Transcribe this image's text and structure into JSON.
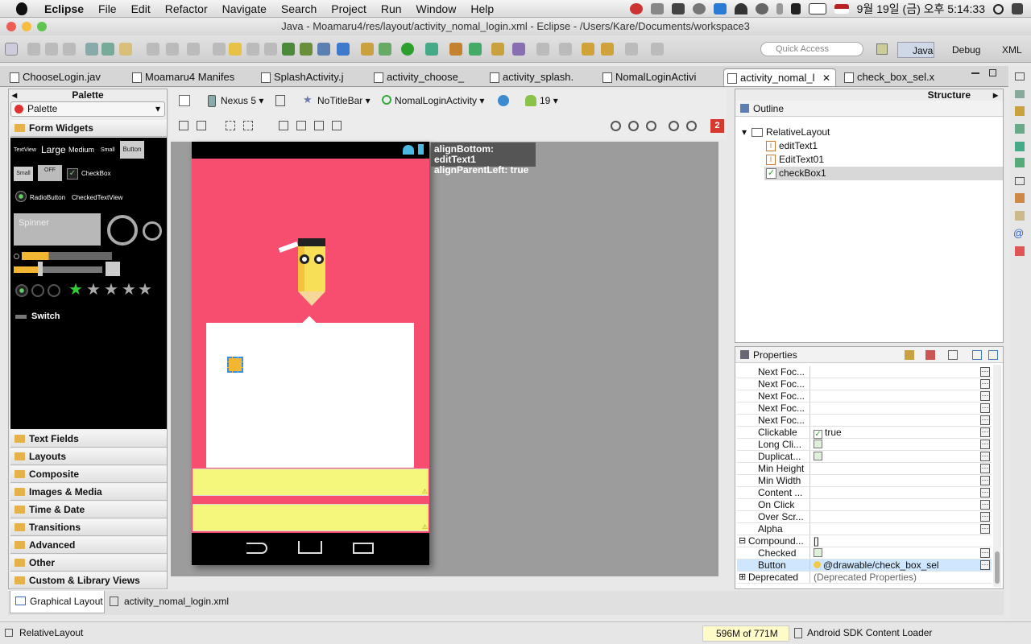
{
  "menubar": {
    "app": "Eclipse",
    "items": [
      "File",
      "Edit",
      "Refactor",
      "Navigate",
      "Search",
      "Project",
      "Run",
      "Window",
      "Help"
    ],
    "clock": "9월 19일 (금) 오후  5:14:33"
  },
  "window": {
    "title": "Java - Moamaru4/res/layout/activity_nomal_login.xml - Eclipse - /Users/Kare/Documents/workspace3"
  },
  "toolbar": {
    "quick_access_placeholder": "Quick Access",
    "perspectives": [
      "Java",
      "Debug",
      "XML"
    ]
  },
  "editor_tabs": [
    "ChooseLogin.jav",
    "Moamaru4 Manifes",
    "SplashActivity.j",
    "activity_choose_",
    "activity_splash.",
    "NomalLoginActivi",
    "activity_nomal_l",
    "check_box_sel.x"
  ],
  "palette": {
    "title": "Palette",
    "dropdown": "Palette",
    "categories_top": [
      "Form Widgets"
    ],
    "widget_labels": {
      "textview": "TextView",
      "large": "Large",
      "medium": "Medium",
      "small": "Small",
      "button": "Button",
      "small_btn": "Small",
      "off": "OFF",
      "checkbox": "CheckBox",
      "radio": "RadioButton",
      "checkedtext": "CheckedTextView",
      "spinner": "Spinner",
      "switch": "Switch"
    },
    "categories": [
      "Text Fields",
      "Layouts",
      "Composite",
      "Images & Media",
      "Time & Date",
      "Transitions",
      "Advanced",
      "Other",
      "Custom & Library Views"
    ]
  },
  "canvas_toolbar": {
    "device": "Nexus 5",
    "theme": "NoTitleBar",
    "activity": "NomalLoginActivity",
    "api": "19",
    "error_count": "2"
  },
  "tooltip": {
    "line1": "alignBottom: editText1",
    "line2": "alignParentLeft: true"
  },
  "structure": {
    "title": "Structure",
    "outline_title": "Outline",
    "tree": [
      "RelativeLayout",
      "editText1",
      "EditText01",
      "checkBox1"
    ]
  },
  "properties": {
    "title": "Properties",
    "rows": [
      {
        "name": "Next Foc...",
        "value": ""
      },
      {
        "name": "Next Foc...",
        "value": ""
      },
      {
        "name": "Next Foc...",
        "value": ""
      },
      {
        "name": "Next Foc...",
        "value": ""
      },
      {
        "name": "Next Foc...",
        "value": ""
      },
      {
        "name": "Clickable",
        "value": "true"
      },
      {
        "name": "Long Cli...",
        "value": ""
      },
      {
        "name": "Duplicat...",
        "value": ""
      },
      {
        "name": "Min Height",
        "value": ""
      },
      {
        "name": "Min Width",
        "value": ""
      },
      {
        "name": "Content ...",
        "value": ""
      },
      {
        "name": "On Click",
        "value": ""
      },
      {
        "name": "Over Scr...",
        "value": ""
      },
      {
        "name": "Alpha",
        "value": ""
      },
      {
        "name": "Compound...",
        "value": "[]"
      },
      {
        "name": "Checked",
        "value": ""
      },
      {
        "name": "Button",
        "value": "@drawable/check_box_sel"
      },
      {
        "name": "Deprecated",
        "value": "(Deprecated Properties)"
      }
    ]
  },
  "bottom_tabs": [
    "Graphical Layout",
    "activity_nomal_login.xml"
  ],
  "status": {
    "selection": "RelativeLayout",
    "memory": "596M of 771M",
    "loader": "Android SDK Content Loader"
  },
  "colors": {
    "phone_bg": "#f74d6f",
    "edittext": "#f5f77d",
    "selected_row": "#cfe6ff"
  }
}
